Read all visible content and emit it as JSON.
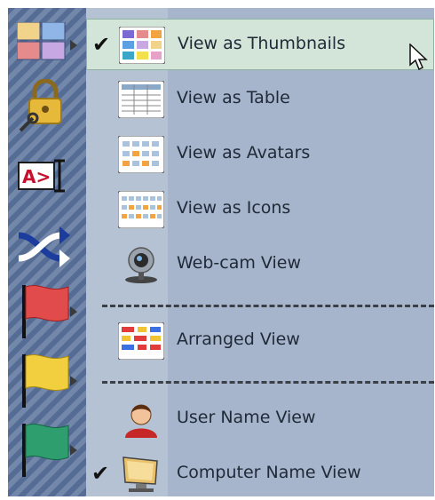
{
  "toolbar": {
    "buttons": [
      {
        "name": "view-toggle",
        "icon": "grid-icon"
      },
      {
        "name": "lock",
        "icon": "lock-key-icon"
      },
      {
        "name": "command",
        "icon": "command-prompt-icon",
        "text": "A>"
      },
      {
        "name": "shuffle",
        "icon": "shuffle-icon"
      },
      {
        "name": "red-flag",
        "icon": "red-flag-icon"
      },
      {
        "name": "yellow-flag",
        "icon": "yellow-flag-icon"
      },
      {
        "name": "green-flag",
        "icon": "green-flag-icon"
      }
    ]
  },
  "menu": {
    "items": [
      {
        "label": "View as Thumbnails",
        "checked": true,
        "highlighted": true
      },
      {
        "label": "View as Table"
      },
      {
        "label": "View as Avatars"
      },
      {
        "label": "View as Icons"
      },
      {
        "label": "Web-cam View"
      },
      {
        "label": "Arranged View"
      },
      {
        "label": "User Name View"
      },
      {
        "label": "Computer Name View",
        "checked": true
      }
    ],
    "check_glyph": "✔"
  },
  "colors": {
    "highlight_bg": "#d2e5d8",
    "menu_bg": "#a6b5cc",
    "toolbar_bg": "#556c94"
  }
}
